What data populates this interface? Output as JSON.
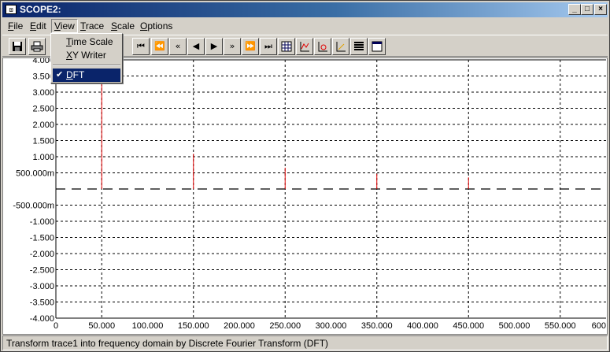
{
  "window": {
    "title": "SCOPE2:",
    "app_icon": "scope-icon",
    "controls": [
      "minimize-icon",
      "maximize-icon",
      "close-icon"
    ]
  },
  "menubar": {
    "items": [
      {
        "label": "File",
        "underline": "F",
        "rest": "ile"
      },
      {
        "label": "Edit",
        "underline": "E",
        "rest": "dit"
      },
      {
        "label": "View",
        "underline": "V",
        "rest": "iew"
      },
      {
        "label": "Trace",
        "underline": "T",
        "rest": "race"
      },
      {
        "label": "Scale",
        "underline": "S",
        "rest": "cale"
      },
      {
        "label": "Options",
        "underline": "O",
        "rest": "ptions"
      }
    ],
    "active": "View"
  },
  "view_menu": {
    "items": [
      {
        "label": "Time Scale",
        "underline": "T",
        "rest": "ime Scale",
        "checked": false
      },
      {
        "label": "XY Writer",
        "underline": "X",
        "rest": "Y Writer",
        "checked": false
      },
      {
        "label": "DFT",
        "underline": "D",
        "rest": "FT",
        "checked": true
      }
    ]
  },
  "toolbar": {
    "buttons": [
      "save-icon",
      "print-icon",
      "first-icon",
      "fast-rewind-icon",
      "rewind-icon",
      "step-back-icon",
      "play-icon",
      "forward-icon",
      "fast-forward-icon",
      "last-icon",
      "grid-icon",
      "trace-icon",
      "lo-icon",
      "xy-icon",
      "list-icon",
      "window-icon"
    ]
  },
  "chart_data": {
    "type": "bar",
    "xlim": [
      0,
      600
    ],
    "ylim": [
      -4,
      4
    ],
    "x_ticks": [
      "0",
      "50.000",
      "100.000",
      "150.000",
      "200.000",
      "250.000",
      "300.000",
      "350.000",
      "400.000",
      "450.000",
      "500.000",
      "550.000",
      "600"
    ],
    "y_ticks": [
      {
        "value": 4,
        "label": "4.000"
      },
      {
        "value": 3.5,
        "label": "3.500"
      },
      {
        "value": 3,
        "label": "3.000"
      },
      {
        "value": 2.5,
        "label": "2.500"
      },
      {
        "value": 2,
        "label": "2.000"
      },
      {
        "value": 1.5,
        "label": "1.500"
      },
      {
        "value": 1,
        "label": "1.000"
      },
      {
        "value": 0.5,
        "label": "500.000m"
      },
      {
        "value": -0.5,
        "label": "-500.000m"
      },
      {
        "value": -1,
        "label": "-1.000"
      },
      {
        "value": -1.5,
        "label": "-1.500"
      },
      {
        "value": -2,
        "label": "-2.000"
      },
      {
        "value": -2.5,
        "label": "-2.500"
      },
      {
        "value": -3,
        "label": "-3.000"
      },
      {
        "value": -3.5,
        "label": "-3.500"
      },
      {
        "value": -4,
        "label": "-4.000"
      }
    ],
    "x_gridlines": [
      50,
      150,
      250,
      350,
      450,
      550
    ],
    "y_gridlines": [
      3.5,
      3,
      2.5,
      2,
      1.5,
      1,
      0.5,
      -0.5,
      -1,
      -1.5,
      -2,
      -2.5,
      -3,
      -3.5
    ],
    "spikes": [
      {
        "x": 50,
        "y": 3.27
      },
      {
        "x": 150,
        "y": 1.09
      },
      {
        "x": 250,
        "y": 0.66
      },
      {
        "x": 350,
        "y": 0.47
      },
      {
        "x": 450,
        "y": 0.36
      }
    ],
    "spike_color": "#e00000",
    "grid": true
  },
  "status": {
    "text": "Transform trace1 into frequency domain by Discrete Fourier Transform (DFT)"
  }
}
